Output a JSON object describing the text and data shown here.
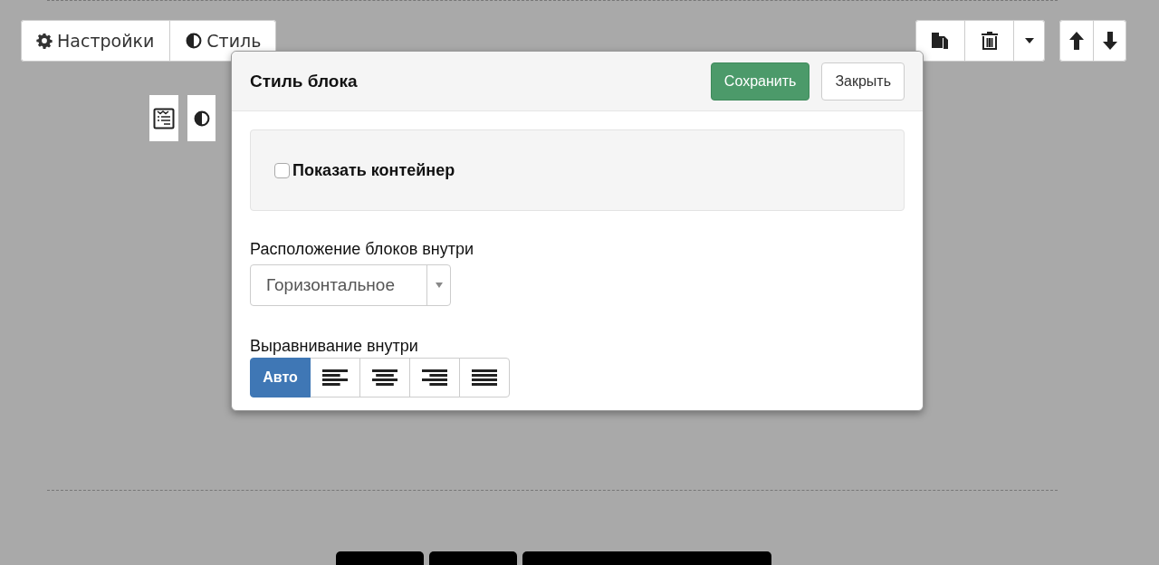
{
  "toolbar": {
    "tabs": [
      {
        "kind": "gear",
        "label": "Настройки"
      },
      {
        "kind": "contrast",
        "label": "Стиль"
      }
    ],
    "actions": [
      {
        "kind": "copy"
      },
      {
        "kind": "trash"
      },
      {
        "kind": "caret"
      }
    ],
    "move": [
      {
        "kind": "up"
      },
      {
        "kind": "down"
      }
    ]
  },
  "side_buttons": [
    {
      "kind": "list"
    },
    {
      "kind": "contrast"
    }
  ],
  "dialog": {
    "title": "Стиль блока",
    "buttons": [
      {
        "kind": "primary",
        "label": "Сохранить"
      },
      {
        "kind": "default",
        "label": "Закрыть"
      }
    ],
    "container_checkbox": {
      "label": "Показать контейнер",
      "checked": false
    },
    "layout_select": {
      "label": "Расположение блоков внутри",
      "value": "Горизонтальное"
    },
    "alignment": {
      "label": "Выравнивание внутри",
      "options": [
        {
          "kind": "text",
          "label": "Авто",
          "selected": true
        },
        {
          "kind": "left",
          "selected": false
        },
        {
          "kind": "center",
          "selected": false
        },
        {
          "kind": "right",
          "selected": false
        },
        {
          "kind": "justify",
          "selected": false
        }
      ]
    }
  }
}
